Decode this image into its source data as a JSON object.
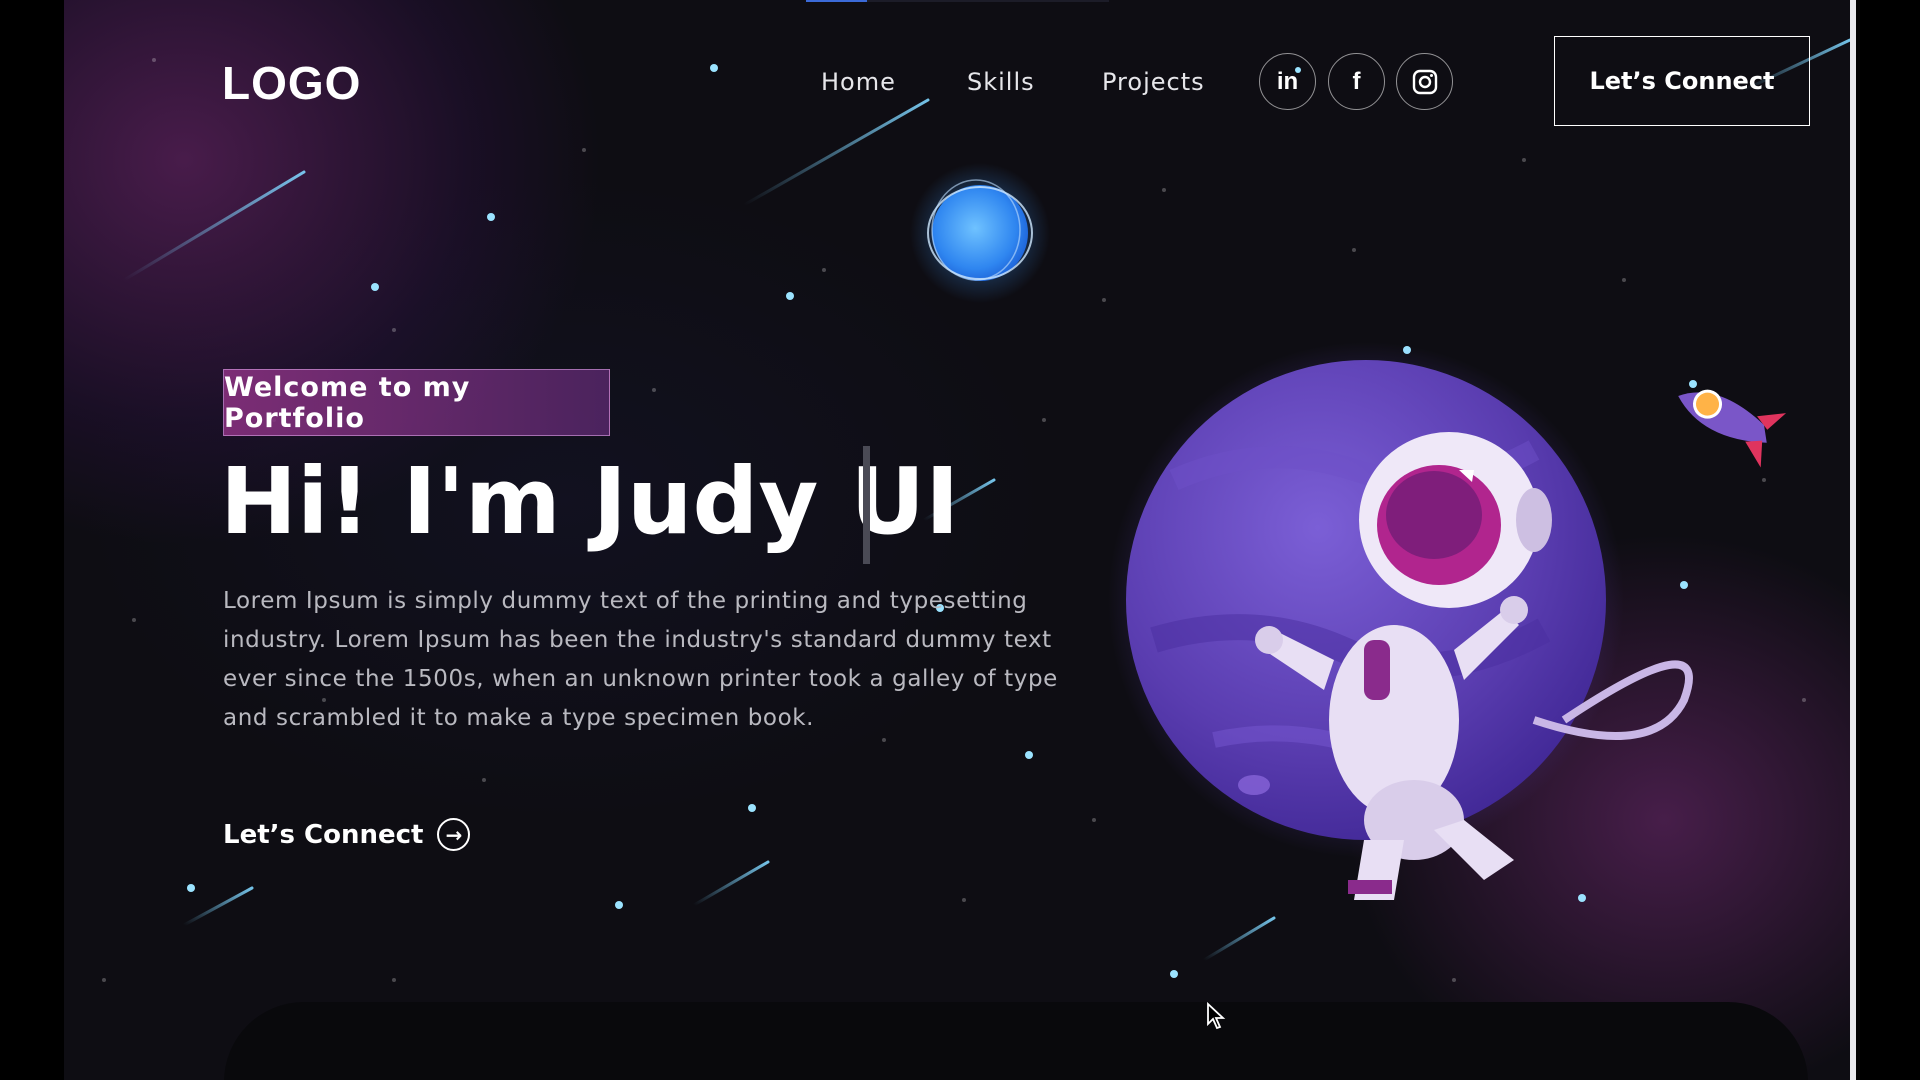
{
  "nav": {
    "logo": "LOGO",
    "links": [
      "Home",
      "Skills",
      "Projects"
    ],
    "social": [
      {
        "icon": "linkedin-icon",
        "glyph": "in"
      },
      {
        "icon": "facebook-icon",
        "glyph": "f"
      },
      {
        "icon": "instagram-icon",
        "glyph": ""
      }
    ],
    "connect_button": "Let’s Connect"
  },
  "hero": {
    "tagline": "Welcome to my Portfolio",
    "title": "Hi! I'm Judy UI",
    "description": "Lorem Ipsum is simply dummy text of the printing and typesetting industry. Lorem Ipsum has been the industry's standard dummy text ever since the 1500s, when an unknown printer took a galley of type and scrambled it to make a type specimen book.",
    "cta": "Let’s Connect"
  },
  "colors": {
    "background": "#0e0d13",
    "accent_purple": "#8c3282",
    "planet": "#5a3db0",
    "star": "#7fd6ff"
  },
  "page_progress": 0.2
}
